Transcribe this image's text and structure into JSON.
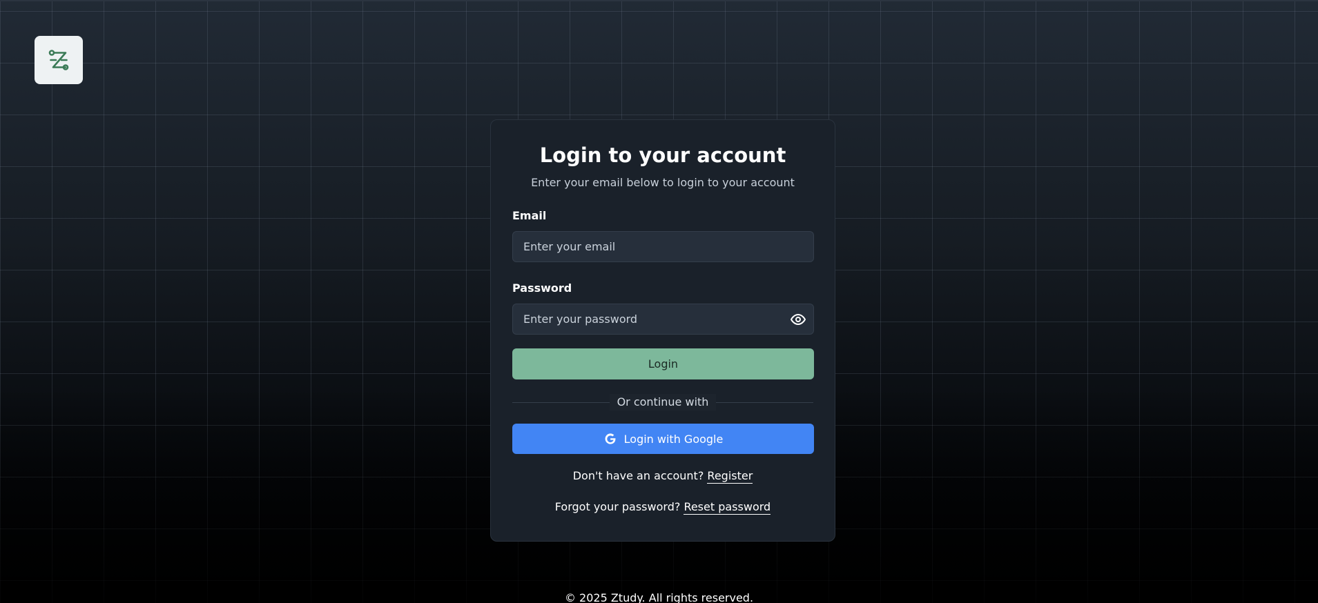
{
  "brand": {
    "logo_icon": "ztudy-logo-icon",
    "accent_color": "#3a7a56"
  },
  "login_card": {
    "title": "Login to your account",
    "subtitle": "Enter your email below to login to your account",
    "email": {
      "label": "Email",
      "placeholder": "Enter your email",
      "value": ""
    },
    "password": {
      "label": "Password",
      "placeholder": "Enter your password",
      "value": "",
      "toggle_icon": "eye-icon"
    },
    "login_button": "Login",
    "divider_text": "Or continue with",
    "google_button": {
      "label": "Login with Google",
      "icon": "google-icon"
    },
    "register_prompt": {
      "text": "Don't have an account?",
      "link": "Register"
    },
    "reset_prompt": {
      "text": "Forgot your password?",
      "link": "Reset password"
    }
  },
  "colors": {
    "login_button": "#7db89b",
    "google_button": "#4285f4",
    "card_background": "#1a212a"
  },
  "footer": {
    "copyright": "© 2025 Ztudy. All rights reserved."
  }
}
